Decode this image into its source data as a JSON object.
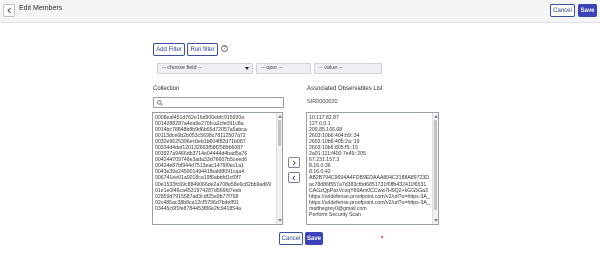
{
  "header": {
    "title": "Edit Members",
    "cancel_label": "Cancel",
    "save_label": "Save"
  },
  "filter": {
    "add_filter_label": "Add Filter",
    "run_filter_label": "Run filter",
    "field_placeholder": "-- choose field --",
    "operator_placeholder": "-- oper --",
    "value_placeholder": "-- value --"
  },
  "collection": {
    "label": "Collection",
    "items": [
      "0008eaf451d762e16d900ebfc915920a",
      "0014288287a4ea9e276fca2cfe091c8a",
      "0014bc78848b8b9d6b65d72057a5abca",
      "00113dce6b2b053c5698c78112507a72",
      "0032e9625396ec0eb1b604f82d71b087",
      "00334d4def120132663f58f2589b6087",
      "003927a9466db3714e04444d4bad5a76",
      "004244709748e3ada33d76607b5ceed6",
      "00424e87bf944d7513eac1476f0ec1a1",
      "0043e39e24590149441fbafd8091caa4",
      "006741ee01a0018ca19f6abbfd1cf0f7",
      "00e1533fc69c8849066de2a708e58e6c82bb9ad69",
      "01e1e0f46ca4531974287d566fd7eeb",
      "02859d7915587ad3cdf25e9b77f768",
      "02c485ac38b8ca12cf5796d7bdeff91",
      "03445c6f1fe8784453f86e2fc941854a"
    ]
  },
  "associated": {
    "label": "Associated Observables List",
    "sub_label": "SIR0000020",
    "items": [
      "10.117.82.87",
      "127.0.0.1",
      "209.85.166.68",
      "2603:10b6:404:b9::34",
      "2603:10b6:405:2a::19",
      "2603:10b6:805:f5::15",
      "2a01:111:f400:7e49::205",
      "67.231.157.3",
      "8.16.0.36",
      "8.16.0.42",
      "AB2B794C9694A4FDB9EDAAA804C3188A89723D",
      "ac78d86f557a7d383cfbd6851731f6ffb432411f6531",
      "CAGzQpPaxVcxqY89Am0CCww7H9Q2+kGG5Ga3",
      "https://urldefense.proofpoint.com/v2/url?u=https-3A_",
      "https://urldefense.proofpoint.com/v2/url?u=https-3A_",
      "matthegrey0@gmail.com",
      "Perform Security Scan"
    ]
  },
  "footer": {
    "cancel_label": "Cancel",
    "save_label": "Save"
  },
  "icons": {
    "back": "chevron-left-icon",
    "help": "question-circle-icon",
    "search": "search-icon",
    "add": "chevron-right-icon",
    "remove": "chevron-left-icon"
  },
  "colors": {
    "primary": "#3b43b8",
    "outline": "#3a4f9f",
    "header_bg": "#f4f5f7"
  }
}
